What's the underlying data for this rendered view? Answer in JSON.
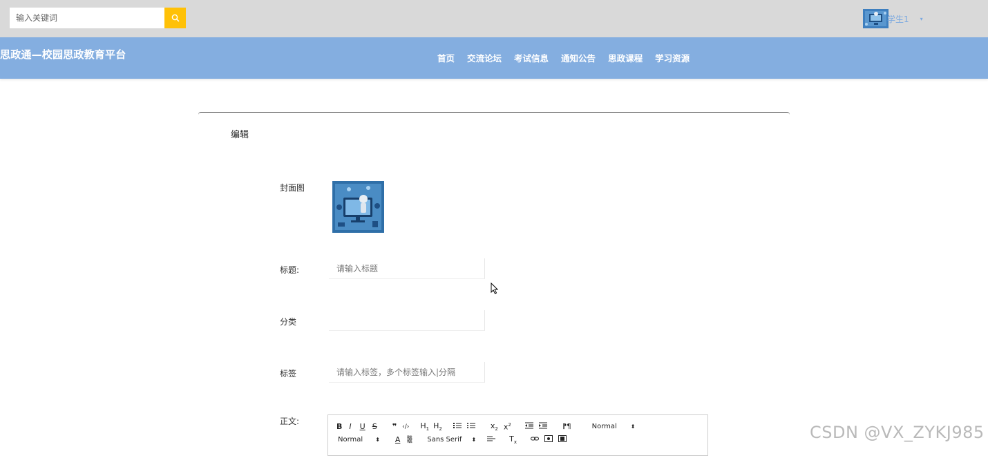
{
  "search": {
    "placeholder": "输入关键词",
    "button_icon": "search-icon"
  },
  "user": {
    "name": "学生1",
    "caret": "▾"
  },
  "site": {
    "title": "思政通—校园思政教育平台"
  },
  "nav": {
    "items": [
      {
        "label": "首页"
      },
      {
        "label": "交流论坛"
      },
      {
        "label": "考试信息"
      },
      {
        "label": "通知公告"
      },
      {
        "label": "思政课程"
      },
      {
        "label": "学习资源"
      }
    ]
  },
  "form": {
    "title": "编辑",
    "cover_label": "封面图",
    "title_label": "标题:",
    "title_placeholder": "请输入标题",
    "category_label": "分类",
    "category_value": "",
    "tags_label": "标签",
    "tags_placeholder": "请输入标签，多个标签输入|分隔",
    "content_label": "正文:"
  },
  "editor": {
    "header_select": "Normal",
    "size_select": "Normal",
    "font_select": "Sans Serif"
  },
  "watermark": "CSDN @VX_ZYKJ985",
  "colors": {
    "topbar": "#d9d9d9",
    "navbar": "#84aee0",
    "search_button": "#ffc107",
    "user_link": "#7aa8e0"
  }
}
